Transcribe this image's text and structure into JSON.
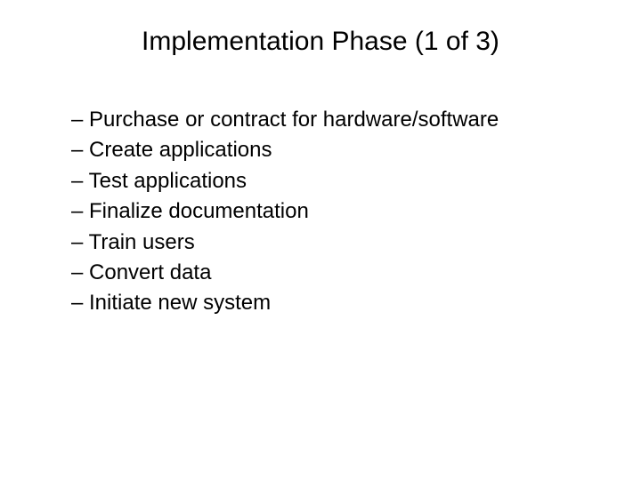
{
  "title": "Implementation Phase (1 of 3)",
  "bullets": [
    "Purchase or contract for hardware/software",
    "Create applications",
    "Test applications",
    "Finalize documentation",
    "Train users",
    "Convert data",
    "Initiate new system"
  ]
}
